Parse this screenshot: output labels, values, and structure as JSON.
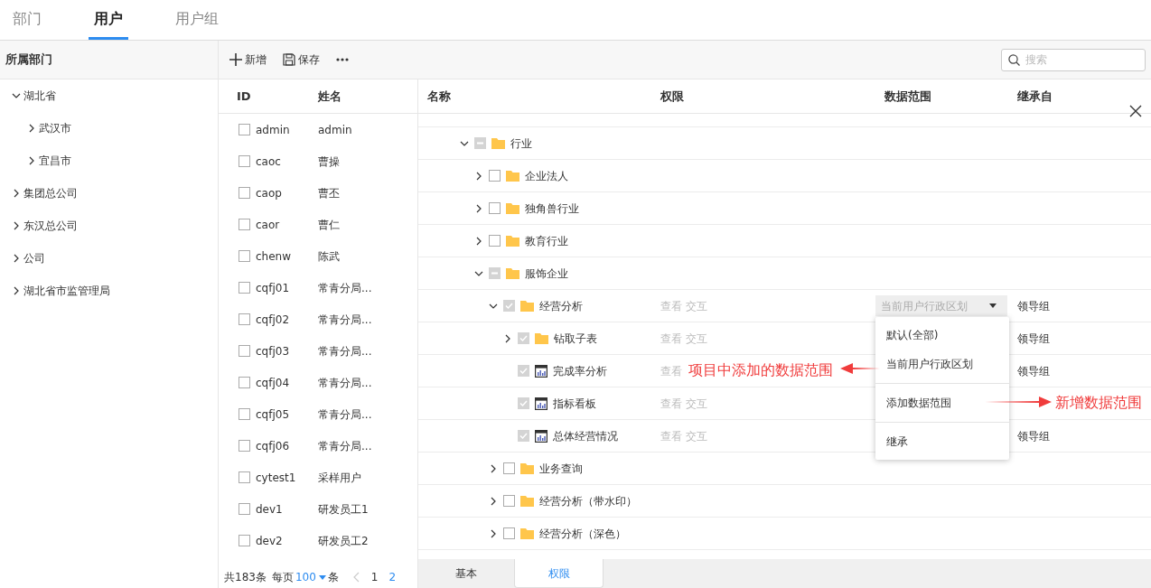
{
  "top_tabs": [
    {
      "label": "部门",
      "selected": false
    },
    {
      "label": "用户",
      "selected": true
    },
    {
      "label": "用户组",
      "selected": false
    }
  ],
  "department_panel": {
    "title": "所属部门",
    "tree": [
      {
        "name": "湖北省",
        "expanded": true,
        "children": [
          {
            "name": "武汉市",
            "expanded": false
          },
          {
            "name": "宜昌市",
            "expanded": false
          }
        ]
      },
      {
        "name": "集团总公司",
        "expanded": false
      },
      {
        "name": "东汉总公司",
        "expanded": false
      },
      {
        "name": "公司",
        "expanded": false
      },
      {
        "name": "湖北省市监管理局",
        "expanded": false
      }
    ]
  },
  "toolbar": {
    "buttons": [
      {
        "kind": "add",
        "label": "新增"
      },
      {
        "kind": "save",
        "label": "保存"
      },
      {
        "kind": "more"
      }
    ],
    "search": {
      "placeholder": "搜索"
    }
  },
  "users": {
    "columns": [
      "ID",
      "姓名"
    ],
    "rows": [
      {
        "id": "admin",
        "name": "admin",
        "checked": false
      },
      {
        "id": "caoc",
        "name": "曹操",
        "checked": false
      },
      {
        "id": "caop",
        "name": "曹丕",
        "checked": false
      },
      {
        "id": "caor",
        "name": "曹仁",
        "checked": false
      },
      {
        "id": "chenw",
        "name": "陈武",
        "checked": false
      },
      {
        "id": "cqfj01",
        "name": "常青分局...",
        "checked": false
      },
      {
        "id": "cqfj02",
        "name": "常青分局...",
        "checked": false
      },
      {
        "id": "cqfj03",
        "name": "常青分局...",
        "checked": false
      },
      {
        "id": "cqfj04",
        "name": "常青分局...",
        "checked": false
      },
      {
        "id": "cqfj05",
        "name": "常青分局...",
        "checked": false
      },
      {
        "id": "cqfj06",
        "name": "常青分局...",
        "checked": false
      },
      {
        "id": "cytest1",
        "name": "采样用户",
        "checked": false
      },
      {
        "id": "dev1",
        "name": "研发员工1",
        "checked": false
      },
      {
        "id": "dev2",
        "name": "研发员工2",
        "checked": false
      }
    ],
    "pager": {
      "total": "共183条",
      "per_page_label": "每页",
      "per_page": "100",
      "unit": "条",
      "pages": [
        {
          "label": "1",
          "selected": false
        },
        {
          "label": "2",
          "selected": true
        }
      ]
    }
  },
  "resources": {
    "columns": [
      "名称",
      "权限",
      "数据范围",
      "继承自"
    ],
    "tree": [
      {
        "name": "行业",
        "kind": "folder",
        "expanded": true,
        "checked": false,
        "indeterminate": true,
        "children": [
          {
            "name": "企业法人",
            "kind": "folder",
            "expanded": false,
            "checked": false,
            "indeterminate": false
          },
          {
            "name": "独角兽行业",
            "kind": "folder",
            "expanded": false,
            "checked": false,
            "indeterminate": false
          },
          {
            "name": "教育行业",
            "kind": "folder",
            "expanded": false,
            "checked": false,
            "indeterminate": false
          },
          {
            "name": "服饰企业",
            "kind": "folder",
            "expanded": true,
            "checked": false,
            "indeterminate": true,
            "children": [
              {
                "name": "经营分析",
                "kind": "folder",
                "expanded": true,
                "checked": true,
                "indeterminate": false,
                "permission": "查看 交互",
                "data_range": {
                  "value": "当前用户行政区划",
                  "open": true,
                  "options": [
                    {
                      "label": "默认(全部)",
                      "divider_before": false
                    },
                    {
                      "label": "当前用户行政区划",
                      "divider_before": false
                    },
                    {
                      "label": "添加数据范围",
                      "divider_before": true
                    },
                    {
                      "label": "继承",
                      "divider_before": true
                    }
                  ]
                },
                "inherited_from": "领导组",
                "children": [
                  {
                    "name": "钻取子表",
                    "kind": "folder",
                    "expanded": false,
                    "checked": true,
                    "indeterminate": false,
                    "permission": "查看 交互",
                    "inherited_from": "领导组"
                  },
                  {
                    "name": "完成率分析",
                    "kind": "report",
                    "checked": true,
                    "indeterminate": false,
                    "permission": "查看",
                    "inherited_from": "领导组"
                  },
                  {
                    "name": "指标看板",
                    "kind": "report",
                    "checked": true,
                    "indeterminate": false,
                    "permission": "查看 交互"
                  },
                  {
                    "name": "总体经营情况",
                    "kind": "report",
                    "checked": true,
                    "indeterminate": false,
                    "permission": "查看 交互",
                    "inherited_from": "领导组"
                  }
                ]
              },
              {
                "name": "业务查询",
                "kind": "folder",
                "expanded": false,
                "checked": false,
                "indeterminate": false
              },
              {
                "name": "经营分析（带水印）",
                "kind": "folder",
                "expanded": false,
                "checked": false,
                "indeterminate": false
              },
              {
                "name": "经营分析（深色）",
                "kind": "folder",
                "expanded": false,
                "checked": false,
                "indeterminate": false
              }
            ]
          }
        ]
      }
    ]
  },
  "annotations": [
    {
      "text": "项目中添加的数据范围",
      "kind": "leftarrow"
    },
    {
      "text": "新增数据范围",
      "kind": "rightarrow"
    }
  ],
  "bottom_tabs": [
    {
      "label": "基本",
      "selected": false
    },
    {
      "label": "权限",
      "selected": true
    }
  ]
}
